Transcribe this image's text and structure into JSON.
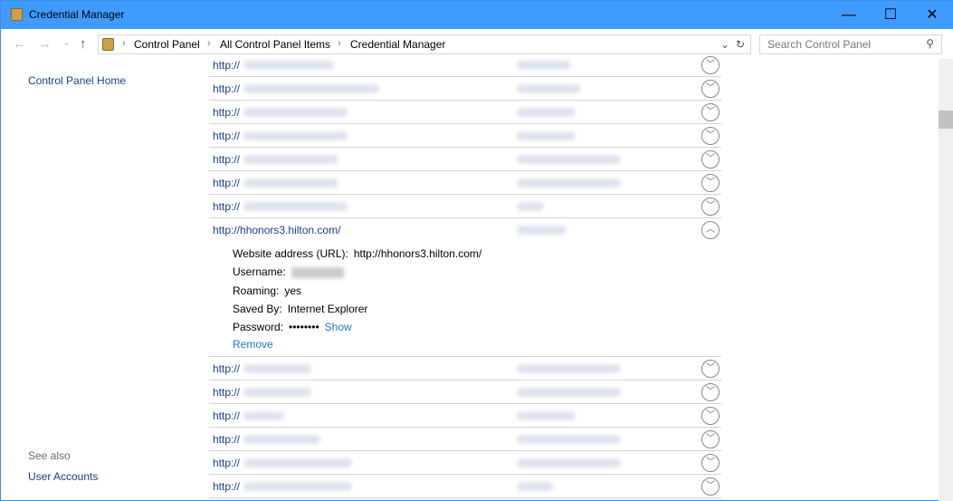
{
  "window": {
    "title": "Credential Manager",
    "minimize": "—",
    "maximize": "☐",
    "close": "✕"
  },
  "nav": {
    "back": "←",
    "forward": "→",
    "recent": "⌄",
    "up": "↑",
    "refresh": "↻",
    "dropdown": "⌄"
  },
  "breadcrumb": [
    "Control Panel",
    "All Control Panel Items",
    "Credential Manager"
  ],
  "search": {
    "placeholder": "Search Control Panel"
  },
  "sidebar": {
    "home": "Control Panel Home",
    "see_also": "See also",
    "user_accounts": "User Accounts"
  },
  "rows_before": [
    {
      "prefix": "http://"
    },
    {
      "prefix": "http://"
    },
    {
      "prefix": "http://"
    },
    {
      "prefix": "http://"
    },
    {
      "prefix": "http://"
    },
    {
      "prefix": "http://"
    },
    {
      "prefix": "http://"
    }
  ],
  "expanded": {
    "url": "http://hhonors3.hilton.com/",
    "address_label": "Website address (URL):",
    "address": "http://hhonors3.hilton.com/",
    "username_label": "Username:",
    "roaming_label": "Roaming:",
    "roaming": "yes",
    "saved_by_label": "Saved By:",
    "saved_by": "Internet Explorer",
    "password_label": "Password:",
    "password": "••••••••",
    "show": "Show",
    "remove": "Remove"
  },
  "rows_after": [
    {
      "prefix": "http://"
    },
    {
      "prefix": "http://"
    },
    {
      "prefix": "http://"
    },
    {
      "prefix": "http://"
    },
    {
      "prefix": "http://"
    },
    {
      "prefix": "http://"
    }
  ]
}
